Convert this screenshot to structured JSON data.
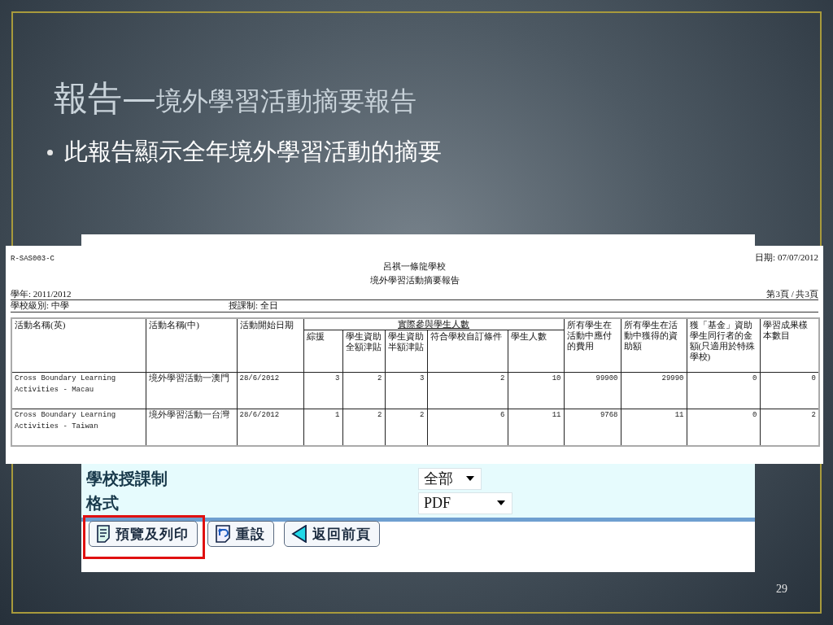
{
  "slide": {
    "title_lead": "報告—",
    "title_rest": "境外學習活動摘要報告",
    "bullet": "此報告顯示全年境外學習活動的摘要",
    "page_number": "29"
  },
  "form": {
    "fields": [
      {
        "label": "學校授課制",
        "value": "全部"
      },
      {
        "label": "格式",
        "value": "PDF"
      }
    ],
    "buttons": [
      {
        "label": "預覽及列印",
        "kind": "document",
        "highlighted": true
      },
      {
        "label": "重設",
        "kind": "reset",
        "highlighted": false
      },
      {
        "label": "返回前頁",
        "kind": "back",
        "highlighted": false
      }
    ]
  },
  "report": {
    "code": "R-SAS003-C",
    "date": "日期: 07/07/2012",
    "school": "呂祺一條龍學校",
    "title": "境外學習活動摘要報告",
    "year": "學年: 2011/2012",
    "page": "第3頁 / 共3頁",
    "level": "學校級別: 中學",
    "mode": "授課制: 全日",
    "columns": [
      "活動名稱(英)",
      "活動名稱(中)",
      "活動開始日期"
    ],
    "group": {
      "label": "實際參與學生人數",
      "columns": [
        "綜援",
        "學生資助全額津貼",
        "學生資助半額津貼",
        "符合學校自訂條件",
        "學生人數"
      ]
    },
    "columns_after": [
      "所有學生在活動中應付的費用",
      "所有學生在活動中獲得的資助額",
      "獲「基金」資助學生同行者的金額(只適用於特殊學校)",
      "學習成果樣本數目"
    ],
    "rows": [
      {
        "cells": [
          "Cross Boundary Learning Activities - Macau",
          "境外學習活動一澳門",
          "28/6/2012",
          "3",
          "2",
          "3",
          "2",
          "10",
          "99900",
          "29990",
          "0",
          "0"
        ]
      },
      {
        "cells": [
          "Cross Boundary Learning Activities - Taiwan",
          "境外學習活動一台灣",
          "28/6/2012",
          "1",
          "2",
          "2",
          "6",
          "11",
          "9768",
          "11",
          "0",
          "2"
        ]
      }
    ]
  }
}
